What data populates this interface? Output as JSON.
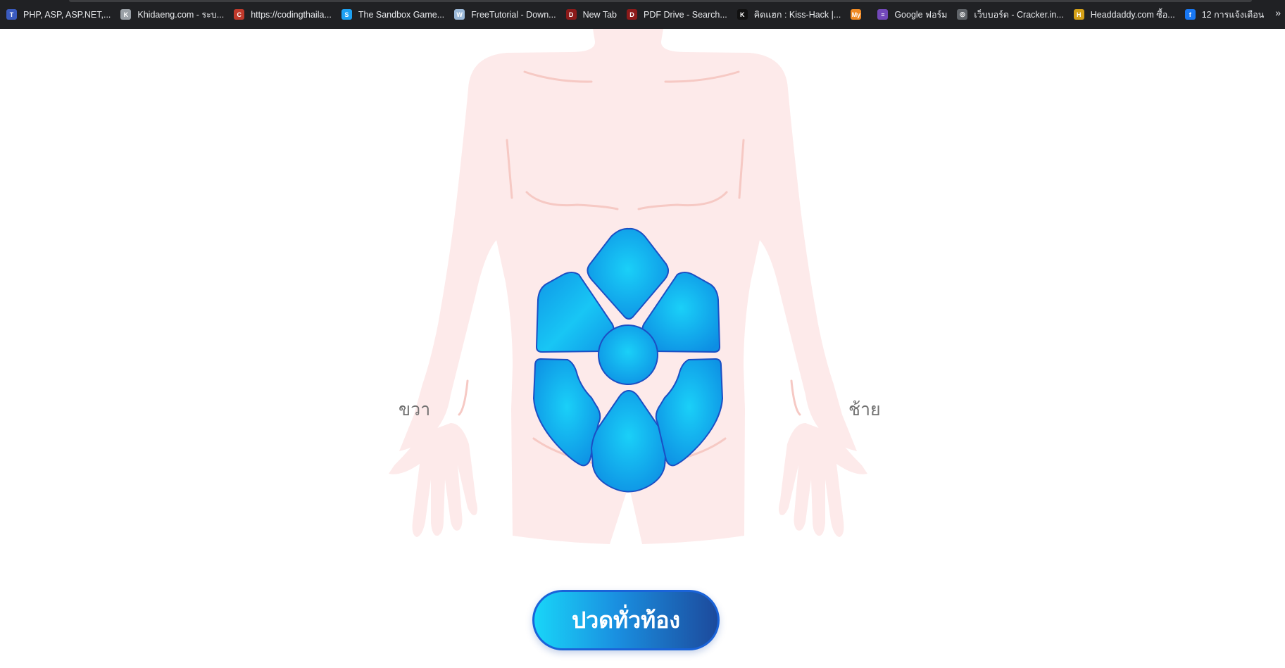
{
  "bookmarks": [
    {
      "label": "PHP, ASP, ASP.NET,...",
      "icon": "thaicreate-icon",
      "icon_color": "#3a5bbf",
      "glyph": "T"
    },
    {
      "label": "Khidaeng.com - ระบ...",
      "icon": "khidaeng-icon",
      "icon_color": "#9aa0a6",
      "glyph": "K"
    },
    {
      "label": "https://codingthaila...",
      "icon": "codingthailand-icon",
      "icon_color": "#c0392b",
      "glyph": "C"
    },
    {
      "label": "The Sandbox Game...",
      "icon": "sandbox-icon",
      "icon_color": "#1da1f2",
      "glyph": "S"
    },
    {
      "label": "FreeTutorial - Down...",
      "icon": "wordpress-icon",
      "icon_color": "#9ab8d8",
      "glyph": "W"
    },
    {
      "label": "New Tab",
      "icon": "pdfdrive-icon",
      "icon_color": "#8b1a1a",
      "glyph": "D"
    },
    {
      "label": "PDF Drive - Search...",
      "icon": "pdfdrive-icon",
      "icon_color": "#8b1a1a",
      "glyph": "D"
    },
    {
      "label": "คิดแฮก : Kiss-Hack |...",
      "icon": "kisshack-icon",
      "icon_color": "#111111",
      "glyph": "K"
    },
    {
      "label": "",
      "icon": "my-icon",
      "icon_color": "#f08a24",
      "glyph": "My"
    },
    {
      "label": "Google ฟอร์ม",
      "icon": "google-forms-icon",
      "icon_color": "#7248b9",
      "glyph": "≡"
    },
    {
      "label": "เว็บบอร์ด - Cracker.in...",
      "icon": "globe-icon",
      "icon_color": "#5f6368",
      "glyph": "◎"
    },
    {
      "label": "Headdaddy.com ซื้อ...",
      "icon": "headdaddy-icon",
      "icon_color": "#d4a017",
      "glyph": "H"
    },
    {
      "label": "12 การแจ้งเตือน",
      "icon": "facebook-icon",
      "icon_color": "#1877f2",
      "glyph": "f"
    }
  ],
  "more_glyph": "»",
  "labels": {
    "right_side": "ขวา",
    "left_side": "ช้าย"
  },
  "action_button": "ปวดทั่วท้อง",
  "colors": {
    "skin": "#fdeaea",
    "skin_line": "#f6c9c4",
    "region_light": "#19c8f5",
    "region_dark": "#0e8fe3",
    "region_border": "#1b4fc4"
  }
}
